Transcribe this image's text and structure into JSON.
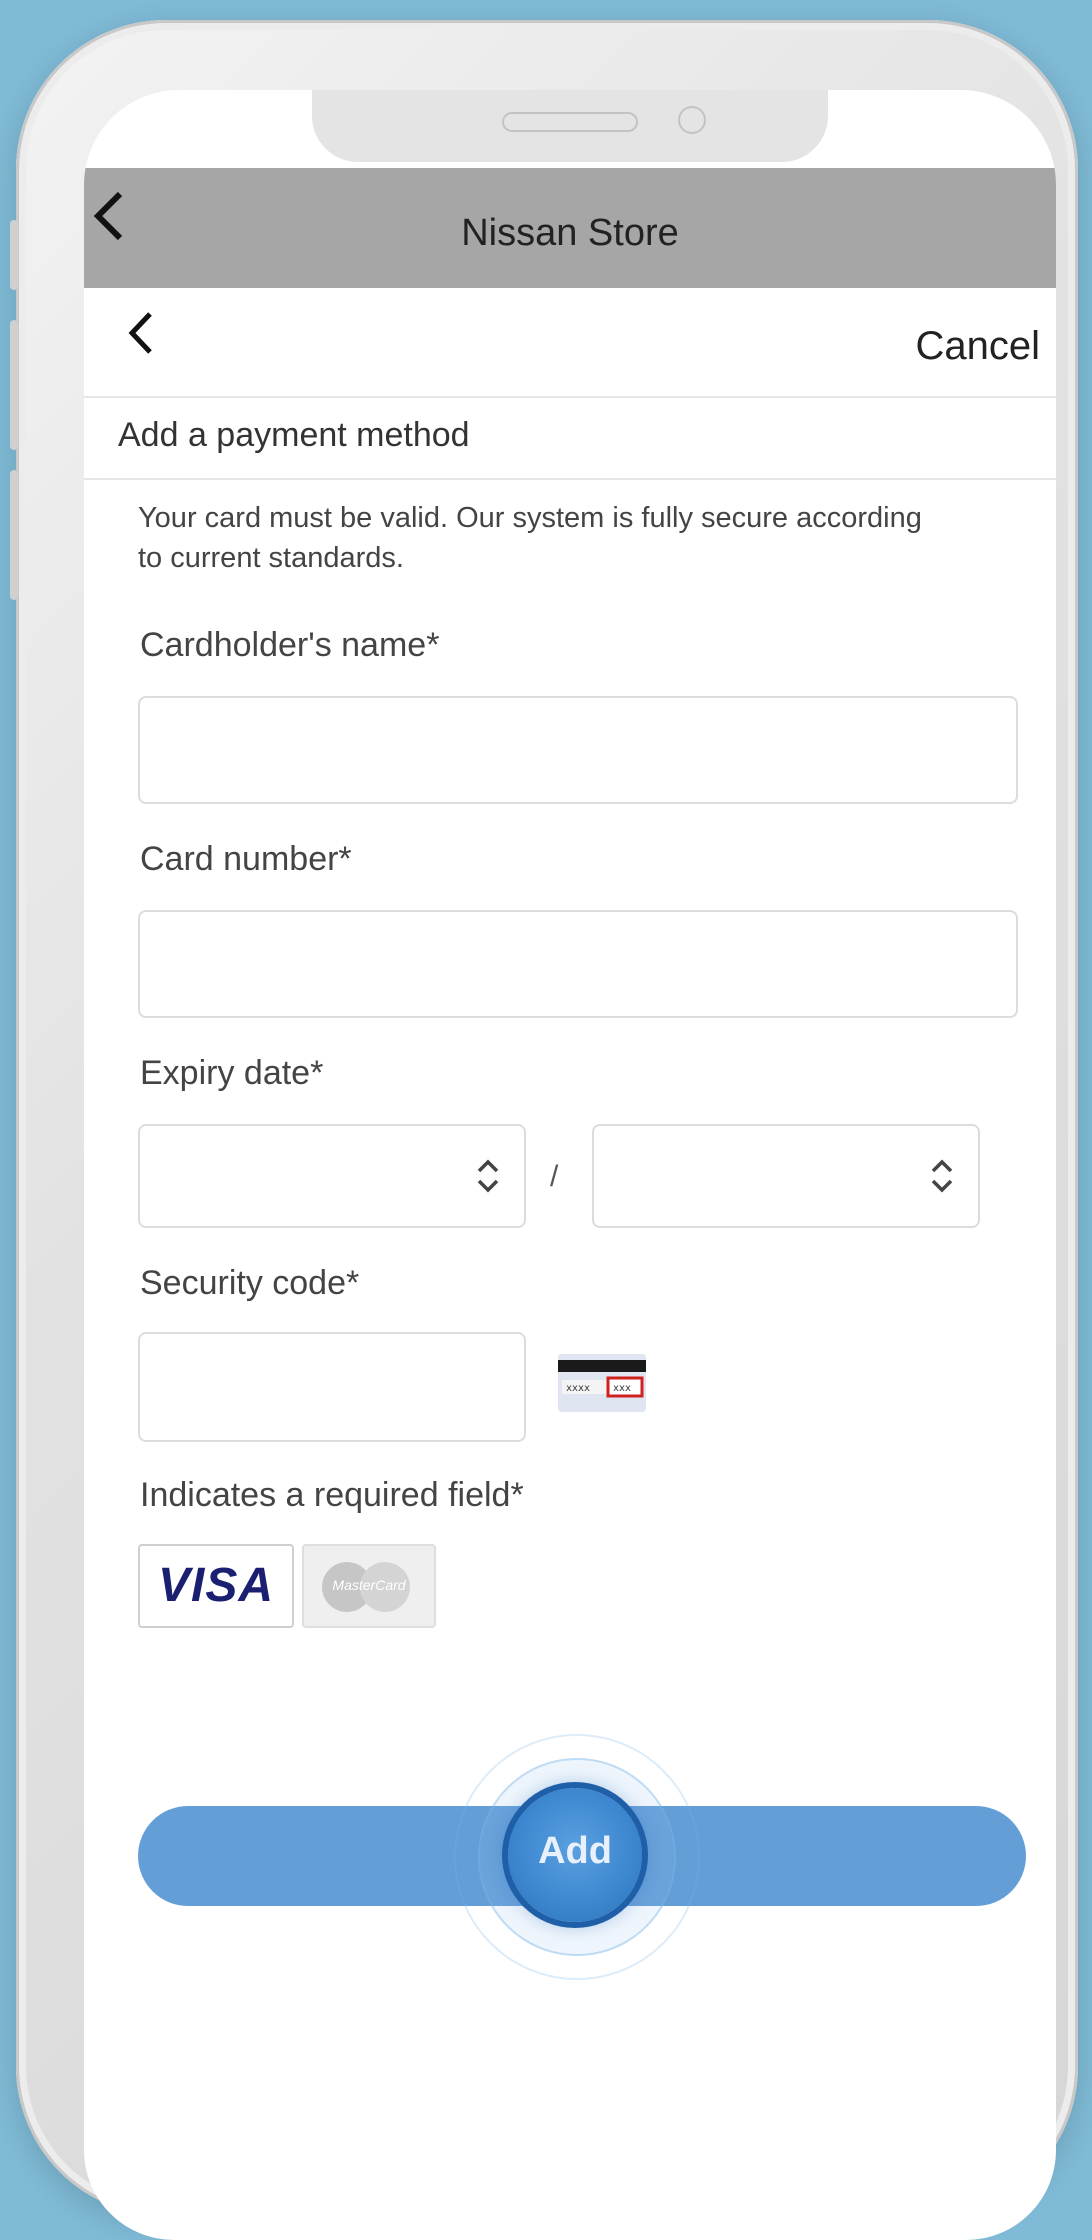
{
  "browser": {
    "title": "Nissan Store"
  },
  "header": {
    "cancel_label": "Cancel"
  },
  "page": {
    "section_title": "Add a payment method",
    "info_text": "Your card must be valid. Our system is fully secure according to current standards."
  },
  "form": {
    "cardholder_label": "Cardholder's name*",
    "cardholder_value": "",
    "card_number_label": "Card number*",
    "card_number_value": "",
    "expiry_label": "Expiry date*",
    "expiry_month_value": "",
    "expiry_year_value": "",
    "expiry_separator": "/",
    "security_label": "Security code*",
    "security_value": "",
    "required_note": "Indicates a required field*"
  },
  "cards": {
    "visa": "VISA",
    "mastercard": "MasterCard"
  },
  "actions": {
    "add_label": "Add"
  },
  "colors": {
    "background": "#7fbad6",
    "button": "#649ed7",
    "top_bar": "#a6a6a6",
    "visa_blue": "#1a1f71"
  }
}
